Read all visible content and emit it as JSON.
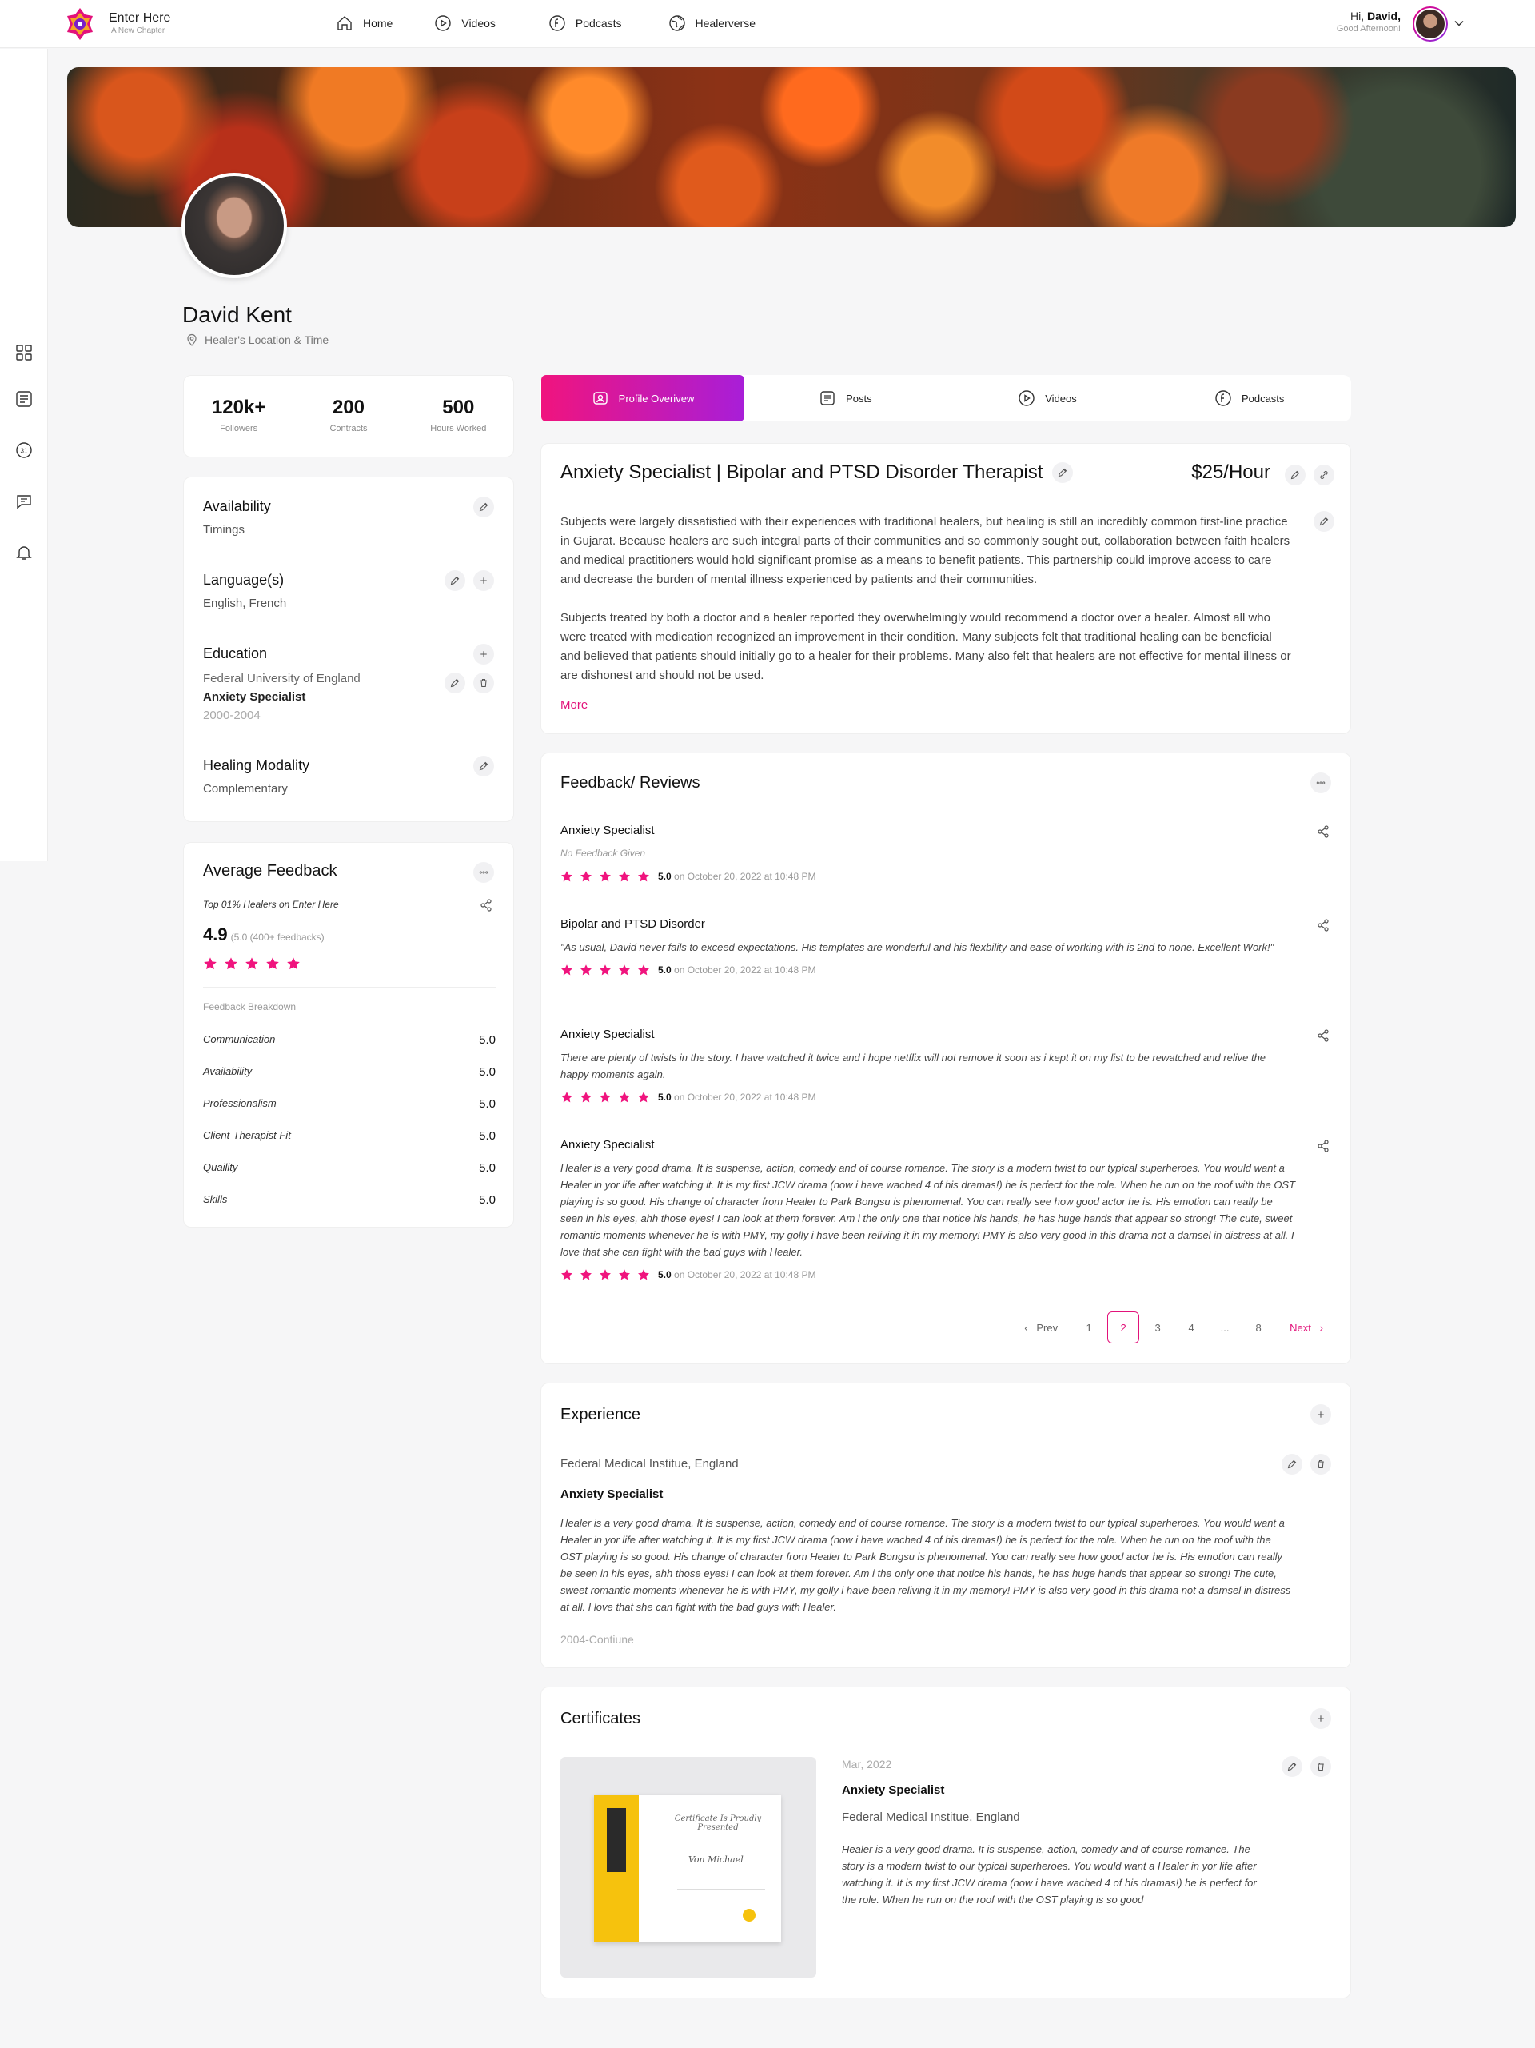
{
  "brand": {
    "name": "Enter Here",
    "tagline": "A New Chapter"
  },
  "nav": [
    {
      "label": "Home",
      "icon": "home-icon"
    },
    {
      "label": "Videos",
      "icon": "play-icon"
    },
    {
      "label": "Podcasts",
      "icon": "podcast-icon"
    },
    {
      "label": "Healerverse",
      "icon": "globe-icon"
    }
  ],
  "user": {
    "greeting": "Hi,",
    "name": "David,",
    "subtitle": "Good Afternoon!"
  },
  "sidebar": [
    "grid-icon",
    "list-icon",
    "calendar-icon",
    "chat-icon",
    "bell-icon"
  ],
  "profile": {
    "name": "David Kent",
    "location": "Healer's Location & Time"
  },
  "stats": [
    {
      "value": "120k+",
      "label": "Followers"
    },
    {
      "value": "200",
      "label": "Contracts"
    },
    {
      "value": "500",
      "label": "Hours Worked"
    }
  ],
  "info": {
    "availability": {
      "title": "Availability",
      "value": "Timings"
    },
    "languages": {
      "title": "Language(s)",
      "value": "English, French"
    },
    "education": {
      "title": "Education",
      "school": "Federal University of England",
      "degree": "Anxiety Specialist",
      "years": "2000-2004"
    },
    "modality": {
      "title": "Healing Modality",
      "value": "Complementary"
    }
  },
  "avg_feedback": {
    "title": "Average Feedback",
    "top": "Top 01% Healers on Enter Here",
    "score": "4.9",
    "score_sub": "(5.0 (400+ feedbacks)",
    "stars": 5,
    "breakdown_title": "Feedback Breakdown",
    "breakdown": [
      {
        "name": "Communication",
        "value": "5.0"
      },
      {
        "name": "Availability",
        "value": "5.0"
      },
      {
        "name": "Professionalism",
        "value": "5.0"
      },
      {
        "name": "Client-Therapist Fit",
        "value": "5.0"
      },
      {
        "name": "Quaility",
        "value": "5.0"
      },
      {
        "name": "Skills",
        "value": "5.0"
      }
    ]
  },
  "tabs": [
    {
      "label": "Profile Overivew",
      "icon": "profile-icon",
      "active": true
    },
    {
      "label": "Posts",
      "icon": "posts-icon",
      "active": false
    },
    {
      "label": "Videos",
      "icon": "play-icon",
      "active": false
    },
    {
      "label": "Podcasts",
      "icon": "podcast-icon",
      "active": false
    }
  ],
  "about": {
    "title": "Anxiety Specialist | Bipolar and PTSD Disorder Therapist",
    "price": "$25/Hour",
    "p1": "Subjects were largely dissatisfied with their experiences with traditional healers, but healing is still an incredibly common first-line practice in Gujarat. Because healers are such integral parts of their communities and so commonly sought out, collaboration between faith healers and medical practitioners would hold significant promise as a means to benefit patients. This partnership could improve access to care and decrease the burden of mental illness experienced by patients and their communities.",
    "p2": "Subjects treated by both a doctor and a healer reported they overwhelmingly would recommend a doctor over a healer. Almost all who were treated with medication recognized an improvement in their condition. Many subjects felt that traditional healing can be beneficial and believed that patients should initially go to a healer for their problems. Many also felt that healers are not effective for mental illness or are dishonest and should not be used.",
    "more": "More"
  },
  "reviews": {
    "title": "Feedback/ Reviews",
    "items": [
      {
        "title": "Anxiety Specialist",
        "text": "No Feedback Given",
        "rating": "5.0",
        "date": "on October 20, 2022 at 10:48 PM"
      },
      {
        "title": "Bipolar and PTSD Disorder",
        "text": "\"As usual, David never fails to exceed expectations. His templates are wonderful and his flexbility and ease of working with is 2nd to none. Excellent Work!\"",
        "rating": "5.0",
        "date": "on October 20, 2022 at 10:48 PM"
      },
      {
        "title": "Anxiety Specialist",
        "text": "There are plenty of twists in the story. I have watched it twice and i hope netflix will not remove it soon as i kept it on my list to be rewatched and relive the happy moments again.",
        "rating": "5.0",
        "date": "on October 20, 2022 at 10:48 PM"
      },
      {
        "title": "Anxiety Specialist",
        "text": "Healer is a very good drama. It is suspense, action, comedy and of course romance. The story is a modern twist to our typical superheroes. You would want a Healer in yor life after watching it. It is my first JCW drama (now i have wached 4 of his dramas!) he is perfect for the role. When he run on the roof with the OST playing is so good. His change of character from Healer to Park Bongsu is phenomenal. You can really see how good actor he is. His emotion can really be seen in his eyes, ahh those eyes! I can look at them forever. Am i the only one that notice his hands, he has huge hands that appear so strong! The cute, sweet romantic moments whenever he is with PMY, my golly i have been reliving it in my memory! PMY is also very good in this drama not a damsel in distress at all. I love that she can fight with the bad guys with Healer.",
        "rating": "5.0",
        "date": "on October 20, 2022 at 10:48 PM"
      }
    ],
    "pager": {
      "prev": "Prev",
      "next": "Next",
      "pages": [
        "1",
        "2",
        "3",
        "4",
        "...",
        "8"
      ],
      "current": "2"
    }
  },
  "experience": {
    "title": "Experience",
    "org": "Federal Medical Institue, England",
    "role": "Anxiety Specialist",
    "desc": "Healer is a very good drama. It is suspense, action, comedy and of course romance. The story is a modern twist to our typical superheroes. You would want a Healer in yor life after watching it. It is my first JCW drama (now i have wached 4 of his dramas!) he is perfect for the role. When he run on the roof with the OST playing is so good. His change of character from Healer to Park Bongsu is phenomenal. You can really see how good actor he is. His emotion can really be seen in his eyes, ahh those eyes! I can look at them forever. Am i the only one that notice his hands, he has huge hands that appear so strong! The cute, sweet romantic moments whenever he is with PMY, my golly i have been reliving it in my memory! PMY is also very good in this drama not a damsel in distress at all. I love that she can fight with the bad guys with Healer.",
    "dates": "2004-Contiune"
  },
  "certificates": {
    "title": "Certificates",
    "date": "Mar, 2022",
    "role": "Anxiety Specialist",
    "org": "Federal Medical Institue, England",
    "desc": "Healer is a very good drama. It is suspense, action, comedy and of course romance. The story is a modern twist to our typical superheroes. You would want a Healer in yor life after watching it. It is my first JCW drama (now i have wached 4 of his dramas!) he is perfect for the role. When he run on the roof with the OST playing is so good",
    "image": {
      "heading": "Certificate Is Proudly Presented",
      "name": "Von Michael"
    }
  },
  "colors": {
    "accent": "#e2127a",
    "gradient_start": "#f0147e",
    "gradient_end": "#a81ed8",
    "star": "#f0147e"
  }
}
